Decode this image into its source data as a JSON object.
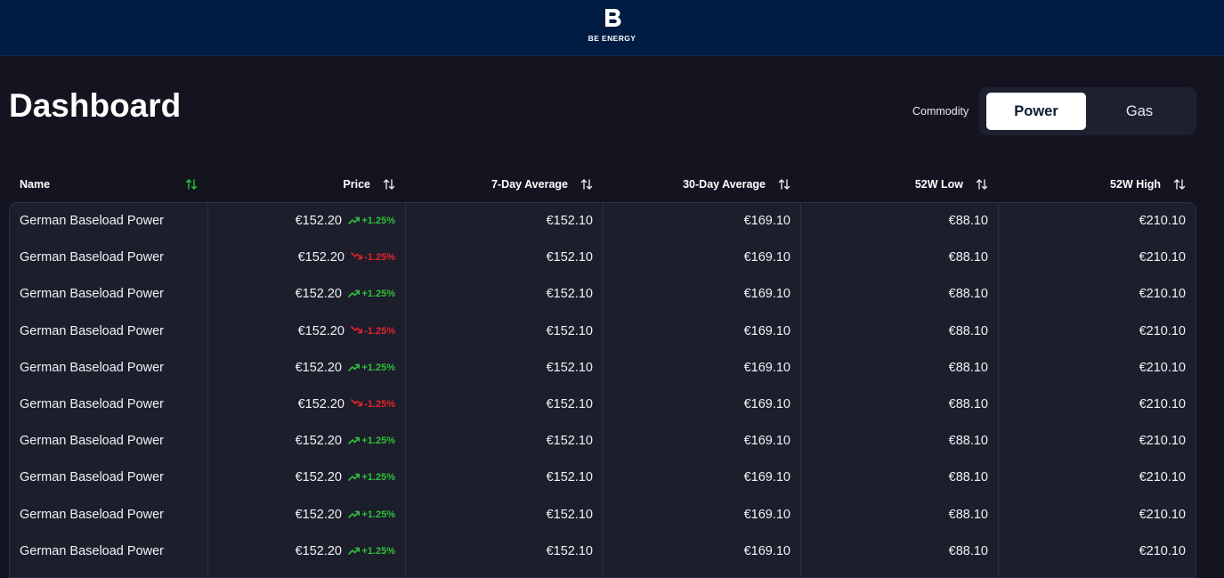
{
  "header": {
    "logo_letter": "B",
    "logo_text": "BE ENERGY"
  },
  "page": {
    "title": "Dashboard"
  },
  "commodity": {
    "label": "Commodity",
    "options": [
      "Power",
      "Gas"
    ],
    "selected": "Power"
  },
  "table": {
    "columns": [
      {
        "label": "Name",
        "sort_icon": "sort-arrows-icon",
        "sort_active": true
      },
      {
        "label": "Price",
        "sort_icon": "sort-arrows-icon",
        "sort_active": false
      },
      {
        "label": "7-Day Average",
        "sort_icon": "sort-arrows-icon",
        "sort_active": false
      },
      {
        "label": "30-Day Average",
        "sort_icon": "sort-arrows-icon",
        "sort_active": false
      },
      {
        "label": "52W Low",
        "sort_icon": "sort-arrows-icon",
        "sort_active": false
      },
      {
        "label": "52W High",
        "sort_icon": "sort-arrows-icon",
        "sort_active": false
      }
    ],
    "rows": [
      {
        "name": "German Baseload Power",
        "price": "€152.20",
        "change": "+1.25%",
        "direction": "up",
        "avg7": "€152.10",
        "avg30": "€169.10",
        "low52": "€88.10",
        "high52": "€210.10"
      },
      {
        "name": "German Baseload Power",
        "price": "€152.20",
        "change": "-1.25%",
        "direction": "down",
        "avg7": "€152.10",
        "avg30": "€169.10",
        "low52": "€88.10",
        "high52": "€210.10"
      },
      {
        "name": "German Baseload Power",
        "price": "€152.20",
        "change": "+1.25%",
        "direction": "up",
        "avg7": "€152.10",
        "avg30": "€169.10",
        "low52": "€88.10",
        "high52": "€210.10"
      },
      {
        "name": "German Baseload Power",
        "price": "€152.20",
        "change": "-1.25%",
        "direction": "down",
        "avg7": "€152.10",
        "avg30": "€169.10",
        "low52": "€88.10",
        "high52": "€210.10"
      },
      {
        "name": "German Baseload Power",
        "price": "€152.20",
        "change": "+1.25%",
        "direction": "up",
        "avg7": "€152.10",
        "avg30": "€169.10",
        "low52": "€88.10",
        "high52": "€210.10"
      },
      {
        "name": "German Baseload Power",
        "price": "€152.20",
        "change": "-1.25%",
        "direction": "down",
        "avg7": "€152.10",
        "avg30": "€169.10",
        "low52": "€88.10",
        "high52": "€210.10"
      },
      {
        "name": "German Baseload Power",
        "price": "€152.20",
        "change": "+1.25%",
        "direction": "up",
        "avg7": "€152.10",
        "avg30": "€169.10",
        "low52": "€88.10",
        "high52": "€210.10"
      },
      {
        "name": "German Baseload Power",
        "price": "€152.20",
        "change": "+1.25%",
        "direction": "up",
        "avg7": "€152.10",
        "avg30": "€169.10",
        "low52": "€88.10",
        "high52": "€210.10"
      },
      {
        "name": "German Baseload Power",
        "price": "€152.20",
        "change": "+1.25%",
        "direction": "up",
        "avg7": "€152.10",
        "avg30": "€169.10",
        "low52": "€88.10",
        "high52": "€210.10"
      },
      {
        "name": "German Baseload Power",
        "price": "€152.20",
        "change": "+1.25%",
        "direction": "up",
        "avg7": "€152.10",
        "avg30": "€169.10",
        "low52": "€88.10",
        "high52": "€210.10"
      }
    ]
  },
  "colors": {
    "header_bg": "#001c42",
    "page_bg": "#13141f",
    "table_bg": "#1c1e2c",
    "up": "#2fbf3a",
    "down": "#e3242b",
    "active_sort": "#2fbf3a"
  }
}
